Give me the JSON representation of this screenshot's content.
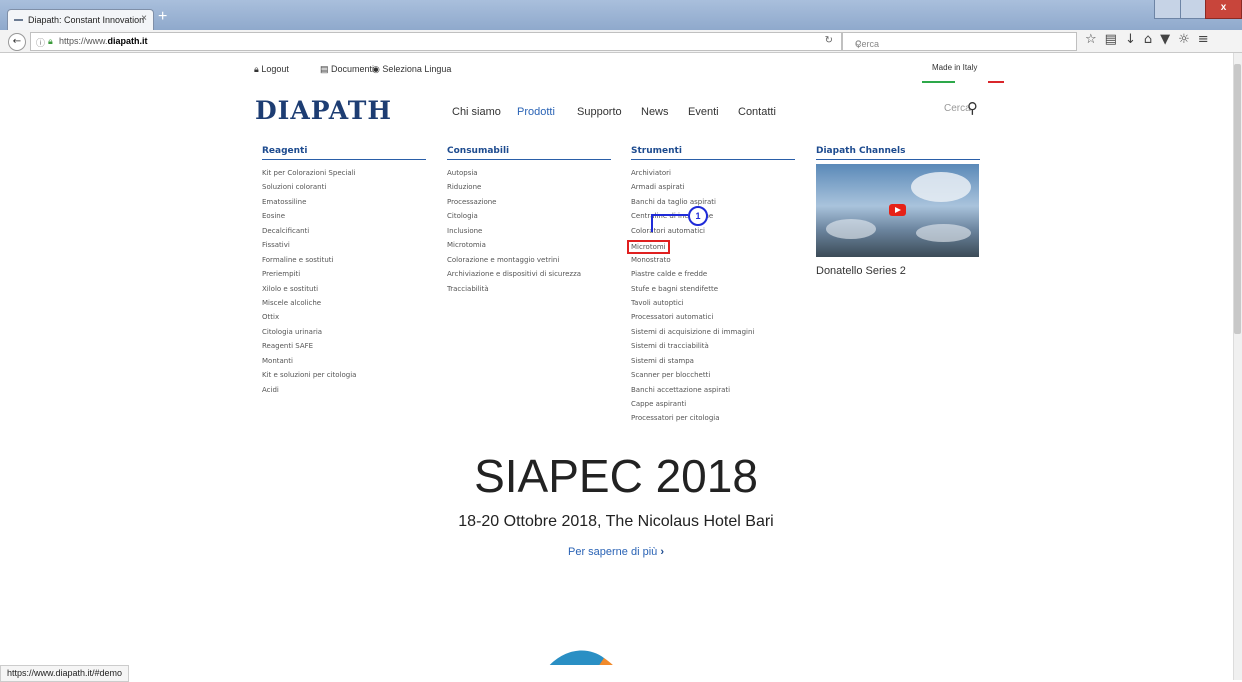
{
  "browser": {
    "tab_title": "Diapath: Constant Innovation",
    "tab_close": "×",
    "new_tab": "+",
    "url_prefix": "https://www.",
    "url_domain": "diapath.it",
    "search_placeholder": "Cerca",
    "status_url": "https://www.diapath.it/#demo",
    "toolbar_icons": [
      "star-icon",
      "reading-list-icon",
      "download-icon",
      "home-icon",
      "pocket-icon",
      "addon-icon",
      "menu-icon"
    ]
  },
  "header": {
    "logout": "Logout",
    "documenti": "Documenti",
    "lingua": "Seleziona Lingua",
    "made_in": "Made in Italy",
    "logo": "DIAPATH",
    "search": "Cerca"
  },
  "nav": [
    "Chi siamo",
    "Prodotti",
    "Supporto",
    "News",
    "Eventi",
    "Contatti"
  ],
  "mega_menu": {
    "reagenti": {
      "title": "Reagenti",
      "items": [
        "Kit per Colorazioni Speciali",
        "Soluzioni coloranti",
        "Ematossiline",
        "Eosine",
        "Decalcificanti",
        "Fissativi",
        "Formaline e sostituti",
        "Preriempiti",
        "Xilolo e sostituti",
        "Miscele alcoliche",
        "Ottix",
        "Citologia urinaria",
        "Reagenti SAFE",
        "Montanti",
        "Kit e soluzioni per citologia",
        "Acidi"
      ]
    },
    "consumabili": {
      "title": "Consumabili",
      "items": [
        "Autopsia",
        "Riduzione",
        "Processazione",
        "Citologia",
        "Inclusione",
        "Microtomia",
        "Colorazione e montaggio vetrini",
        "Archiviazione e dispositivi di sicurezza",
        "Tracciabilità"
      ]
    },
    "strumenti": {
      "title": "Strumenti",
      "items": [
        "Archiviatori",
        "Armadi aspirati",
        "Banchi da taglio aspirati",
        "Centraline di inclusione",
        "Coloratori automatici",
        "Microtomi",
        "Monostrato",
        "Piastre calde e fredde",
        "Stufe e bagni stendifette",
        "Tavoli autoptici",
        "Processatori automatici",
        "Sistemi di acquisizione di immagini",
        "Sistemi di tracciabilità",
        "Sistemi di stampa",
        "Scanner per blocchetti",
        "Banchi accettazione aspirati",
        "Cappe aspiranti",
        "Processatori per citologia"
      ]
    },
    "channels": {
      "title": "Diapath Channels",
      "video_caption": "Donatello Series 2"
    }
  },
  "annotation": {
    "step": "1"
  },
  "hero": {
    "title": "SIAPEC 2018",
    "subtitle": "18-20 Ottobre 2018, The Nicolaus Hotel Bari",
    "link": "Per saperne di più",
    "link_icon": "›"
  },
  "colors": {
    "brand": "#1d3d73",
    "link": "#2a63b5",
    "highlight": "#e02020",
    "annotation": "#1f2bd8"
  }
}
